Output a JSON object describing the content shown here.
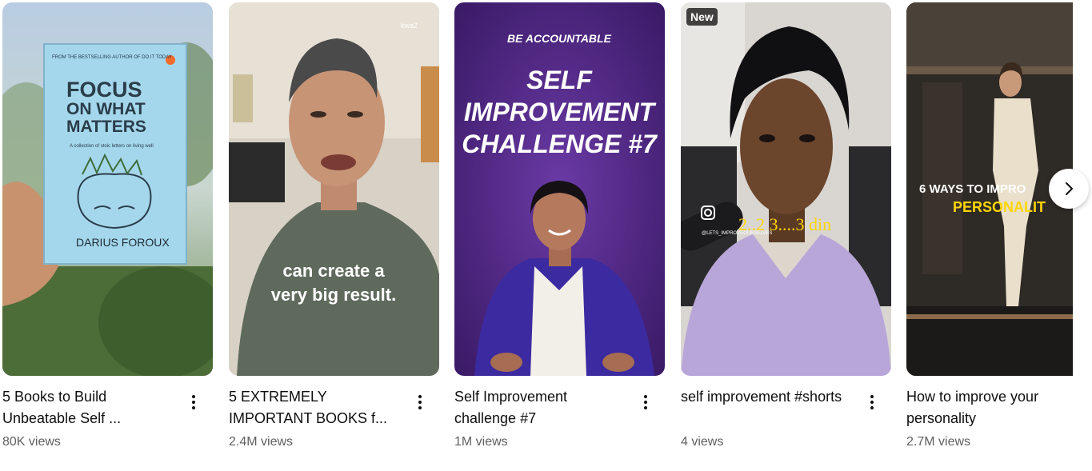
{
  "shorts": [
    {
      "title": "5 Books to Build Unbeatable Self ...",
      "views": "80K views",
      "overlay": {
        "top_line": "FROM THE BESTSELLING AUTHOR OF DO IT TODAY",
        "book_title_1": "FOCUS",
        "book_title_2": "ON WHAT",
        "book_title_3": "MATTERS",
        "subtitle": "A collection of stoic letters on living well",
        "author": "DARIUS FOROUX"
      }
    },
    {
      "title": "5 EXTREMELY IMPORTANT BOOKS f...",
      "views": "2.4M views",
      "overlay": {
        "caption_1": "can create a",
        "caption_2": "very big result."
      }
    },
    {
      "title": "Self Improvement challenge #7",
      "views": "1M views",
      "overlay": {
        "kicker": "BE ACCOUNTABLE",
        "headline_1": "SELF",
        "headline_2": "IMPROVEMENT",
        "headline_3": "CHALLENGE #7"
      }
    },
    {
      "title": "self improvement #shorts",
      "views": "4 views",
      "badge": "New",
      "overlay": {
        "handle": "@LETS_IMPROVEOURSELVES",
        "caption": "2..2   3....3 din"
      }
    },
    {
      "title": "How to improve your personality",
      "views": "2.7M views",
      "overlay": {
        "caption_1": "6 WAYS TO IMPRO",
        "caption_2": "PERSONALIT"
      }
    }
  ],
  "icons": {
    "more": "more-vert-icon",
    "next": "chevron-right-icon",
    "instagram": "instagram-icon"
  },
  "colors": {
    "title": "#0f0f0f",
    "meta": "#606060",
    "overlay_yellow": "#ffd600"
  }
}
